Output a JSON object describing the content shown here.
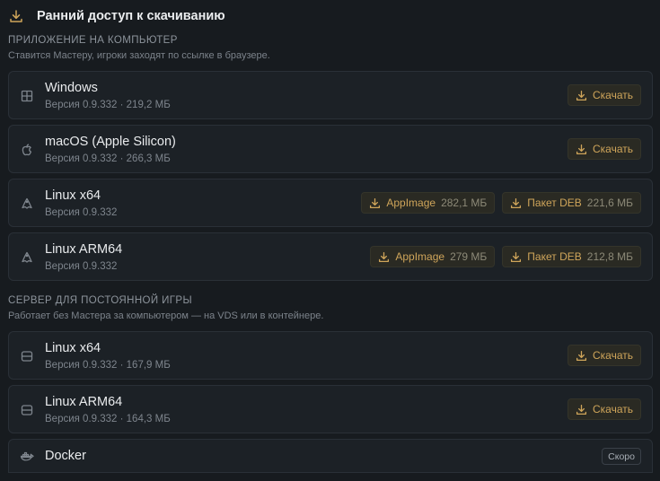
{
  "header": {
    "title": "Ранний доступ к скачиванию",
    "icon": "download-icon"
  },
  "desktop": {
    "title": "ПРИЛОЖЕНИЕ НА КОМПЬЮТЕР",
    "subtitle": "Ставится Мастеру, игроки заходят по ссылке в браузере.",
    "items": [
      {
        "title": "Windows",
        "meta": "Версия 0.9.332 · 219,2 МБ",
        "icon": "windows-icon",
        "download": "Скачать"
      },
      {
        "title": "macOS (Apple Silicon)",
        "meta": "Версия 0.9.332 · 266,3 МБ",
        "icon": "apple-icon",
        "download": "Скачать"
      },
      {
        "title": "Linux x64",
        "meta": "Версия 0.9.332",
        "icon": "linux-icon",
        "appimage": "AppImage",
        "appimage_size": "282,1 МБ",
        "deb": "Пакет DEB",
        "deb_size": "221,6 МБ"
      },
      {
        "title": "Linux ARM64",
        "meta": "Версия 0.9.332",
        "icon": "linux-icon",
        "appimage": "AppImage",
        "appimage_size": "279 МБ",
        "deb": "Пакет DEB",
        "deb_size": "212,8 МБ"
      }
    ]
  },
  "server": {
    "title": "СЕРВЕР ДЛЯ ПОСТОЯННОЙ ИГРЫ",
    "subtitle": "Работает без Мастера за компьютером — на VDS или в контейнере.",
    "items": [
      {
        "title": "Linux x64",
        "meta": "Версия 0.9.332 · 167,9 МБ",
        "icon": "server-icon",
        "download": "Скачать"
      },
      {
        "title": "Linux ARM64",
        "meta": "Версия 0.9.332 · 164,3 МБ",
        "icon": "server-icon",
        "download": "Скачать"
      },
      {
        "title": "Docker",
        "badge": "Скоро",
        "icon": "docker-icon"
      }
    ]
  },
  "colors": {
    "accent": "#cfa55a",
    "background": "#171b1f",
    "card": "#1c2126"
  }
}
